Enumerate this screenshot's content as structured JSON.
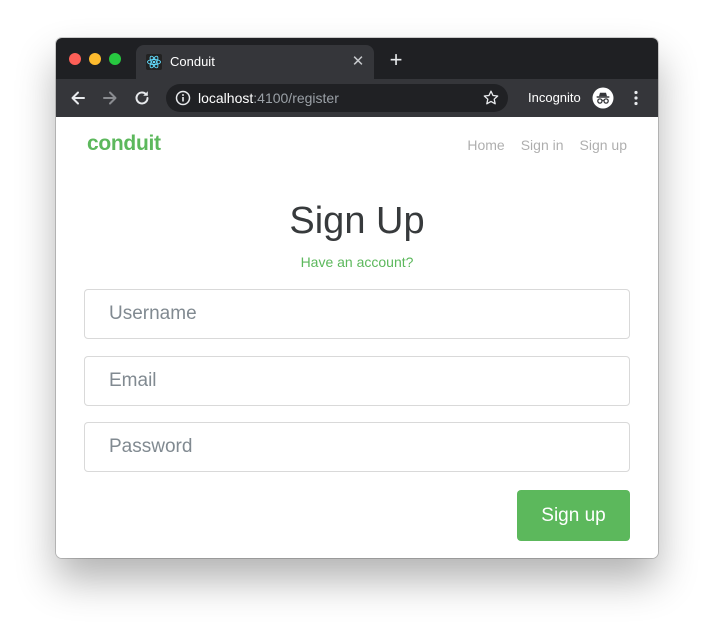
{
  "browser": {
    "tab_title": "Conduit",
    "url_host": "localhost",
    "url_rest": ":4100/register",
    "incognito_label": "Incognito"
  },
  "navbar": {
    "brand": "conduit",
    "links": [
      "Home",
      "Sign in",
      "Sign up"
    ]
  },
  "form": {
    "title": "Sign Up",
    "have_account": "Have an account?",
    "username_placeholder": "Username",
    "email_placeholder": "Email",
    "password_placeholder": "Password",
    "submit_label": "Sign up"
  },
  "colors": {
    "brand": "#5cb85c",
    "chrome_titlebar": "#1f2023",
    "chrome_toolbar": "#35363a"
  },
  "icons": [
    "react-favicon-icon",
    "close-icon",
    "plus-icon",
    "back-arrow-icon",
    "forward-arrow-icon",
    "reload-icon",
    "info-icon",
    "star-icon",
    "incognito-icon",
    "more-vert-icon"
  ]
}
